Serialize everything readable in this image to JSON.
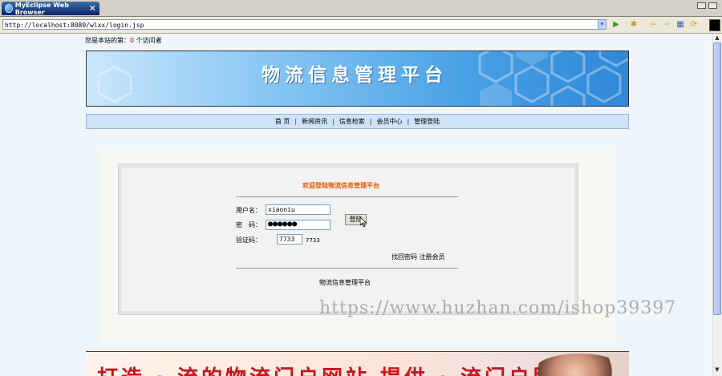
{
  "window": {
    "tab_title": "MyEclipse Web Browser",
    "close_glyph": "✕",
    "tab_icon": "globe-icon"
  },
  "address_bar": {
    "url": "http://localhost:8080/wlxx/login.jsp",
    "dropdown_glyph": "▾",
    "go_glyph": "▶",
    "star_glyph": "✱",
    "back_glyph": "⇦",
    "forward_glyph": "⇨",
    "grid_glyph": "▦",
    "refresh_glyph": "⟳"
  },
  "scrollbar": {
    "up_glyph": "▲",
    "down_glyph": "▼"
  },
  "page": {
    "visitor_prefix": "您是本站的第：",
    "visitor_count": "0",
    "visitor_suffix": " 个访问者",
    "banner_title": "物流信息管理平台",
    "nav": [
      "首 页",
      "新闻资讯",
      "信息检索",
      "会员中心",
      "管理登陆"
    ],
    "nav_sep": "|",
    "welcome": "欢迎登陆物流信息管理平台",
    "form": {
      "username_label": "用户名：",
      "username_value": "xiaoniu",
      "password_label": "密　码：",
      "password_value": "●●●●●●",
      "captcha_label": "验证码：",
      "captcha_value": "7733",
      "captcha_image_text": "7733",
      "login_button": "登陆"
    },
    "links": "找回密码 注册会员",
    "footer": "物流信息管理平台",
    "watermark": "https://www.huzhan.com/ishop39397",
    "ad_text": "打造 · 流的物流门户网站 提供 · 流门户服务"
  },
  "colors": {
    "accent_orange": "#e85c00",
    "visitor_count_red": "#d00000",
    "banner_blue": "#4aa1e5"
  }
}
